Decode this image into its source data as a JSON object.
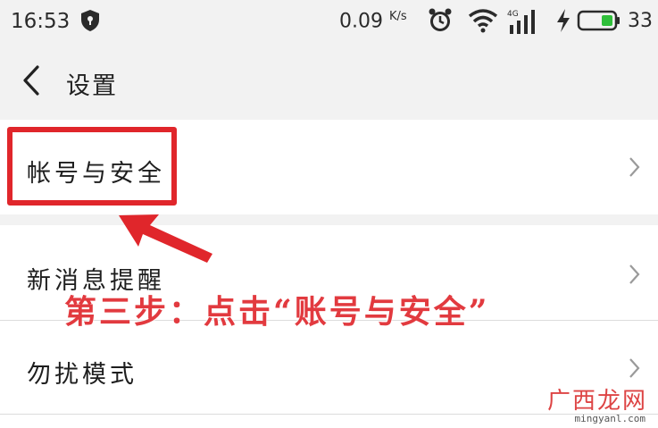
{
  "status_bar": {
    "time": "16:53",
    "net_speed": "0.09",
    "net_speed_unit": "K/s",
    "network_type": "4G",
    "battery_level": "33",
    "icons": [
      "shield-icon",
      "alarm-icon",
      "wifi-icon",
      "signal-icon",
      "charging-icon",
      "battery-icon"
    ]
  },
  "header": {
    "title": "设置",
    "back_icon": "back-arrow-icon"
  },
  "settings": {
    "items": [
      {
        "label": "帐号与安全",
        "icon": "chevron-right-icon"
      },
      {
        "label": "新消息提醒",
        "icon": "chevron-right-icon"
      },
      {
        "label": "勿扰模式",
        "icon": "chevron-right-icon"
      }
    ]
  },
  "annotation": {
    "caption": "第三步：点击“账号与安全”",
    "highlight_color": "#e0262b",
    "caption_color": "#e23a3f"
  },
  "watermark": {
    "title": "广西龙网",
    "url": "mingyanl.com"
  }
}
